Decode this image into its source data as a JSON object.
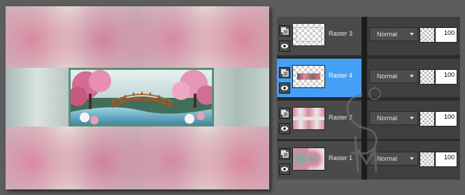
{
  "canvas": {
    "artwork_description_icon": "cherry-blossom-bridge-artwork"
  },
  "layers": [
    {
      "name": "Raster 3",
      "blend_mode": "Normal",
      "opacity": "100",
      "selected": false,
      "thumb": "frame"
    },
    {
      "name": "Raster 4",
      "blend_mode": "Normal",
      "opacity": "100",
      "selected": true,
      "thumb": "bridge"
    },
    {
      "name": "Raster 2",
      "blend_mode": "Normal",
      "opacity": "100",
      "selected": false,
      "thumb": "pink"
    },
    {
      "name": "Raster 1",
      "blend_mode": "Normal",
      "opacity": "100",
      "selected": false,
      "thumb": "pattern"
    }
  ],
  "colors": {
    "selected_row": "#44a0f6",
    "panel_bg": "#2b2b2b",
    "row_bg": "#4a4a4a"
  },
  "icons": {
    "mask": "layer-mask-icon",
    "visibility": "eye-icon",
    "dropdown": "chevron-down-icon"
  }
}
